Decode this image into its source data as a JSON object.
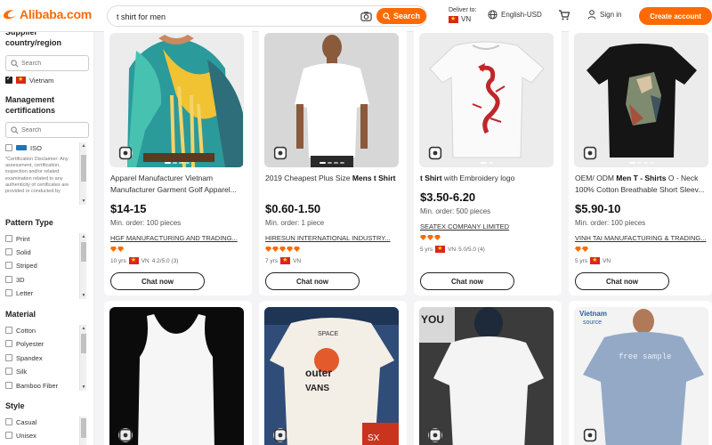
{
  "header": {
    "logo_text": "Alibaba.com",
    "search_value": "t shirt for men",
    "search_button": "Search",
    "deliver_label": "Deliver to:",
    "deliver_country": "VN",
    "language": "English-USD",
    "sign_in": "Sign in",
    "create_account": "Create account",
    "accent_color": "#ff6a00"
  },
  "sidebar": {
    "supplier_country_title": "Supplier country/region",
    "country_search_placeholder": "Search",
    "country_selected": "Vietnam",
    "management_title": "Management certifications",
    "cert_search_placeholder": "Search",
    "cert_option": "ISO",
    "disclaimer": "*Certification Disclaimer: Any assessment, certification, inspection and/or related examination related to any authenticity of certificates are provided or conducted by",
    "pattern_title": "Pattern Type",
    "pattern_options": [
      "Print",
      "Solid",
      "Striped",
      "3D",
      "Letter"
    ],
    "material_title": "Material",
    "material_options": [
      "Cotton",
      "Polyester",
      "Spandex",
      "Silk",
      "Bamboo Fiber"
    ],
    "style_title": "Style",
    "style_options": [
      "Casual",
      "Unisex"
    ]
  },
  "products": [
    {
      "title_pre": "Apparel Manufacturer Vietnam Manufacturer Garment Golf Apparel...",
      "title_bold": "",
      "title_post": "",
      "price": "$14-15",
      "min_order": "Min. order: 100 pieces",
      "supplier": "HGF MANUFACTURING AND TRADING...",
      "meta_years": "10 yrs",
      "meta_country": "VN",
      "meta_rating": "4.2/5.0 (3)",
      "chat": "Chat now"
    },
    {
      "title_pre": "2019 Cheapest Plus Size ",
      "title_bold": "Mens t Shirt",
      "title_post": "",
      "price": "$0.60-1.50",
      "min_order": "Min. order: 1 piece",
      "supplier": "HIRESUN INTERNATIONAL INDUSTRY...",
      "meta_years": "7 yrs",
      "meta_country": "VN",
      "meta_rating": "",
      "chat": "Chat now"
    },
    {
      "title_pre": "",
      "title_bold": "t Shirt",
      "title_post": " with Embroidery logo",
      "price": "$3.50-6.20",
      "min_order": "Min. order: 500 pieces",
      "supplier": "SEATEX COMPANY LIMITED",
      "meta_years": "5 yrs",
      "meta_country": "VN",
      "meta_rating": "5.0/5.0 (4)",
      "chat": "Chat now"
    },
    {
      "title_pre": "OEM/ ODM ",
      "title_bold": "Men T - Shirts",
      "title_post": " O - Neck 100% Cotton Breathable Short Sleev...",
      "price": "$5.90-10",
      "min_order": "Min. order: 100 pieces",
      "supplier": "VINH TAI MANUFACTURING & TRADING...",
      "meta_years": "5 yrs",
      "meta_country": "VN",
      "meta_rating": "",
      "chat": "Chat now"
    }
  ],
  "row2": {
    "watermark_brand": "Vietnam",
    "watermark_sub": "source",
    "watermark_center": "free sample",
    "tshirt_print_top": "SPACE",
    "tshirt_print_mid": "outer",
    "tshirt_print_bot": "VANS",
    "poster_text": "YOU",
    "sign_text": "SX"
  }
}
